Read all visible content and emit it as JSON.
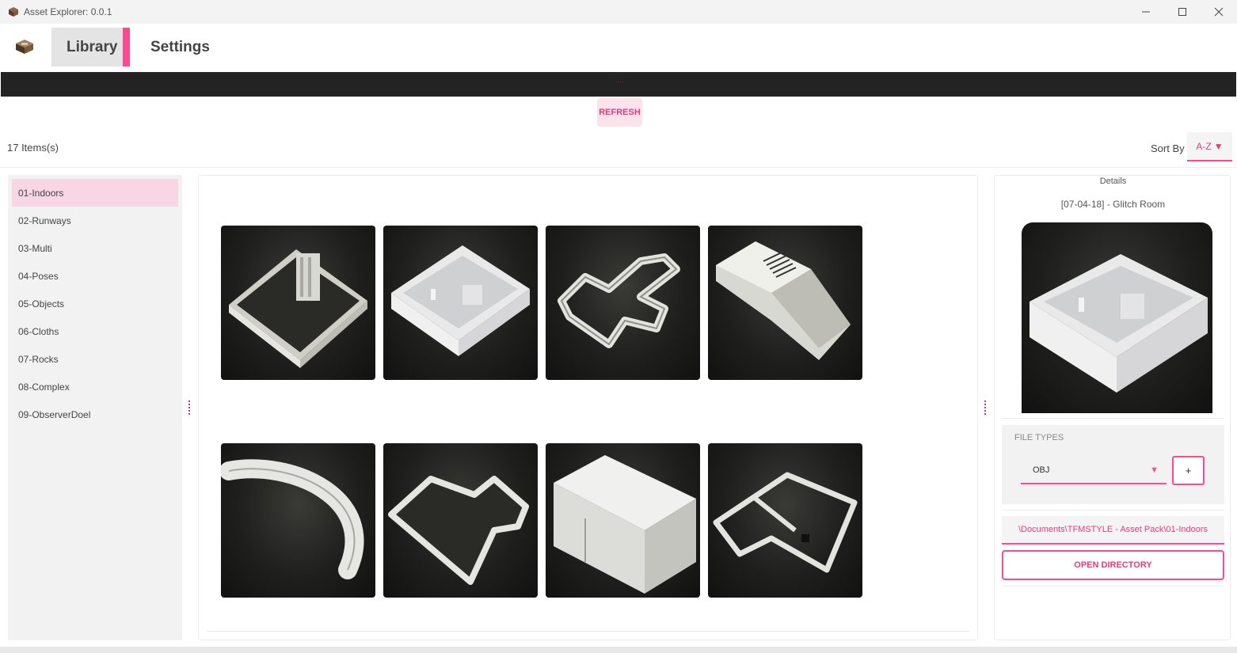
{
  "window": {
    "title": "Asset Explorer: 0.0.1",
    "controls": [
      "minimize-icon",
      "maximize-icon",
      "close-icon"
    ]
  },
  "nav": {
    "tabs": [
      {
        "label": "Library",
        "active": true
      },
      {
        "label": "Settings",
        "active": false
      }
    ]
  },
  "toolbar": {
    "dots": "...",
    "refresh_label": "REFRESH"
  },
  "list_header": {
    "items_count": "17 Items(s)",
    "sort_by_label": "Sort By",
    "sort_value": "A-Z",
    "sort_caret": "▼"
  },
  "sidebar": {
    "items": [
      {
        "label": "01-Indoors",
        "active": true
      },
      {
        "label": "02-Runways",
        "active": false
      },
      {
        "label": "03-Multi",
        "active": false
      },
      {
        "label": "04-Poses",
        "active": false
      },
      {
        "label": "05-Objects",
        "active": false
      },
      {
        "label": "06-Cloths",
        "active": false
      },
      {
        "label": "07-Rocks",
        "active": false
      },
      {
        "label": "08-Complex",
        "active": false
      },
      {
        "label": "09-ObserverDoel",
        "active": false
      }
    ]
  },
  "grid": {
    "thumbnails": [
      {
        "icon": "open-room-model-thumbnail"
      },
      {
        "icon": "glitch-room-model-thumbnail"
      },
      {
        "icon": "winding-corridor-model-thumbnail"
      },
      {
        "icon": "vent-block-model-thumbnail"
      },
      {
        "icon": "curved-tube-model-thumbnail"
      },
      {
        "icon": "cross-room-model-thumbnail"
      },
      {
        "icon": "closed-box-model-thumbnail"
      },
      {
        "icon": "floorplan-rooms-model-thumbnail"
      }
    ]
  },
  "details": {
    "label": "Details",
    "title": "[07-04-18] - Glitch Room",
    "file_types_label": "FILE TYPES",
    "file_type_value": "OBJ",
    "file_type_caret": "▼",
    "add_label": "+",
    "path": "\\Documents\\TFMSTYLE - Asset Pack\\01-Indoors",
    "open_directory_label": "OPEN DIRECTORY"
  },
  "colors": {
    "accent": "#ff4891",
    "accent_text": "#e63b7a",
    "active_item_bg": "#f8d6e3",
    "toolbar_dark": "#232323"
  }
}
